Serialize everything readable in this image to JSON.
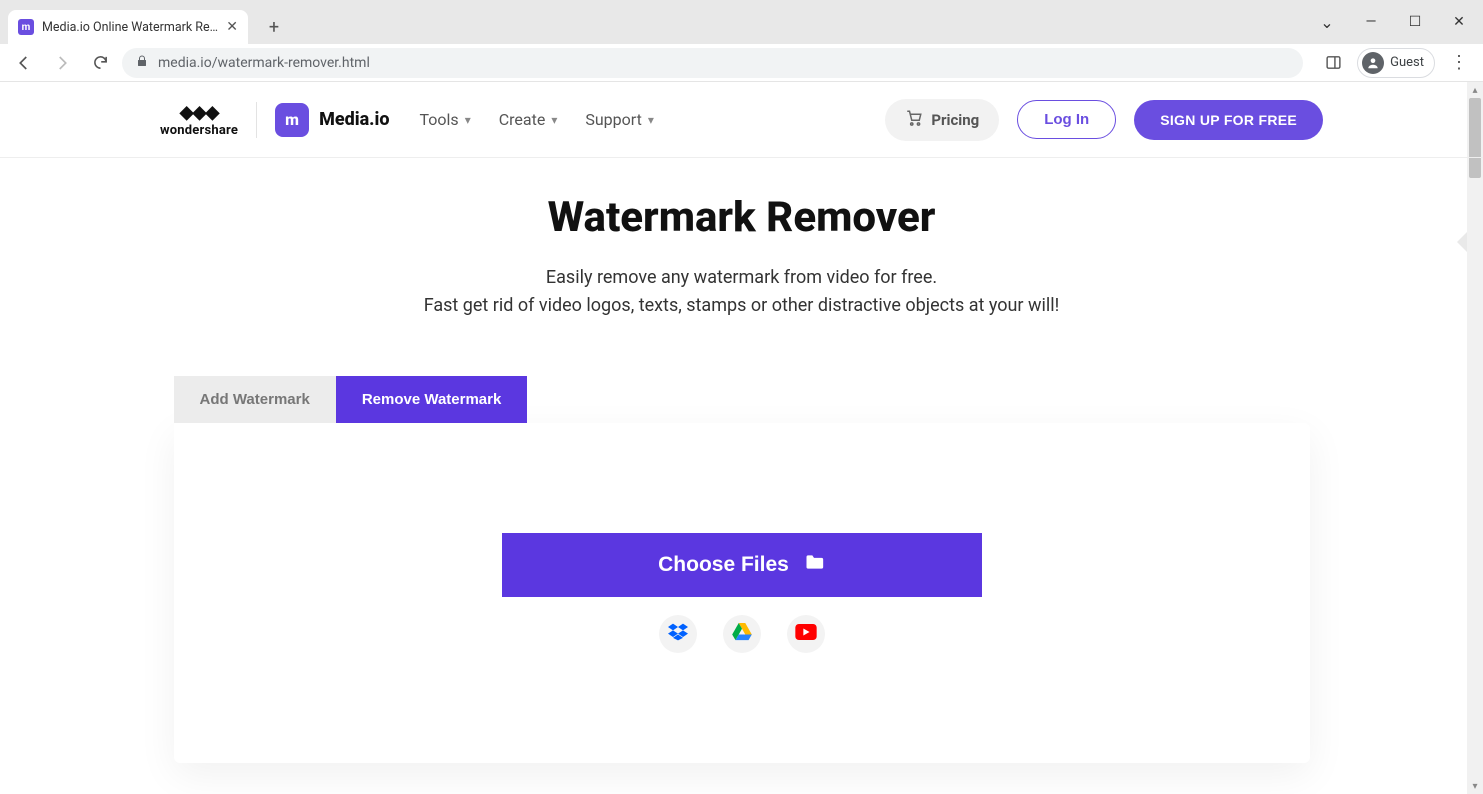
{
  "browser": {
    "tab_title": "Media.io Online Watermark Rem…",
    "url_host": "media.io",
    "url_path": "/watermark-remover.html",
    "guest_label": "Guest"
  },
  "header": {
    "wondershare_label": "wondershare",
    "mediaio_label": "Media.io",
    "nav": {
      "tools": "Tools",
      "create": "Create",
      "support": "Support"
    },
    "pricing": "Pricing",
    "login": "Log In",
    "signup": "SIGN UP FOR FREE"
  },
  "hero": {
    "title": "Watermark Remover",
    "subtitle_line1": "Easily remove any watermark from video for free.",
    "subtitle_line2": "Fast get rid of video logos, texts, stamps or other distractive objects at your will!"
  },
  "tool": {
    "tab_add": "Add Watermark",
    "tab_remove": "Remove Watermark",
    "choose_files": "Choose Files"
  },
  "icons": {
    "dropbox": "dropbox",
    "gdrive": "google-drive",
    "youtube": "youtube"
  }
}
